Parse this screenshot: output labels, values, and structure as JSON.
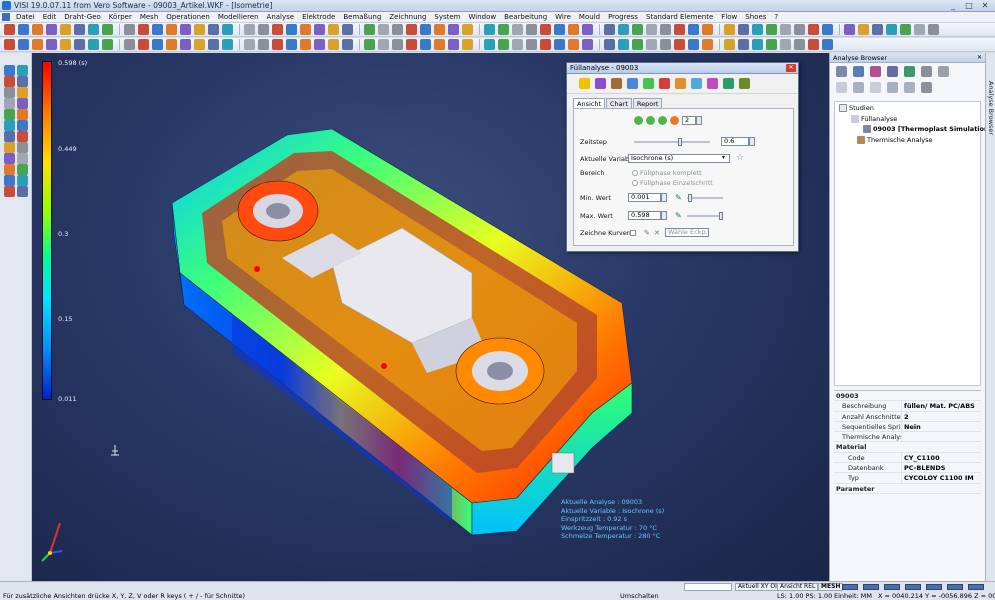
{
  "window": {
    "title": "VISI 19.0.07.11 from Vero Software - 09003_Artikel.WKF - [Isometrie]",
    "controls": [
      "_",
      "□",
      "✕"
    ]
  },
  "menu": [
    "Datei",
    "Edit",
    "Draht-Geo",
    "Körper",
    "Mesh",
    "Operationen",
    "Modellieren",
    "Analyse",
    "Elektrode",
    "Bemaßung",
    "Zeichnung",
    "System",
    "Window",
    "Bearbeitung",
    "Wire",
    "Mould",
    "Progress",
    "Standard Elemente",
    "Flow",
    "Shoes",
    "?"
  ],
  "legend": {
    "max": "0.598 (s)",
    "v1": "0.449",
    "v2": "0.3",
    "v3": "0.15",
    "min": "0.011"
  },
  "info": {
    "lines": [
      "Aktuelle Analyse :  09003",
      "Aktuelle Variable :  Isochrone (s)",
      "Einspritzzeit :  0.92 s",
      "Werkzeug Temperatur :  70 °C",
      "Schmelze Temperatur :  280 °C"
    ]
  },
  "dialog": {
    "title": "Füllanalyse - 09003",
    "close": "✕",
    "tabs": [
      "Ansicht",
      "Chart",
      "Report"
    ],
    "step_value": "2",
    "zeitstep_label": "Zeitstep",
    "zeitstep_value": "0.6",
    "variable_label": "Aktuelle Variable",
    "variable_value": "Isochrone (s)",
    "bereich_label": "Bereich",
    "bereich_opt1": "Füllphase komplett",
    "bereich_opt2": "Füllphase Einzelschritt",
    "min_label": "Min. Wert",
    "min_value": "0.001",
    "max_label": "Max. Wert",
    "max_value": "0.598",
    "curves_label": "Zeichne Kurven",
    "curves_select": "Wähle Eckp."
  },
  "browser": {
    "title": "Analyse Browser",
    "close": "✕",
    "vtab": "Analyse Browser",
    "tree": {
      "root": "Studien",
      "fill": "Füllanalyse",
      "sim": "09003 [Thermoplast Simulation]",
      "thermal": "Thermische Analyse"
    },
    "section_header": "09003",
    "props": [
      {
        "k": "Beschreibung",
        "v": "füllen/ Mat. PC/ABS"
      },
      {
        "k": "Anzahl Anschnitte",
        "v": "2"
      },
      {
        "k": "Sequentielles Spritzen",
        "v": "Nein"
      },
      {
        "k": "Thermische Analyse inkl.",
        "v": ""
      }
    ],
    "material_header": "Material",
    "material": [
      {
        "k": "Code",
        "v": "CY_C1100"
      },
      {
        "k": "Datenbank",
        "v": "PC-BLENDS"
      },
      {
        "k": "Typ",
        "v": "CYCOLOY C1100 IM"
      }
    ],
    "param_header": "Parameter"
  },
  "status": {
    "hint": "Für zusätzliche Ansichten drücke X, Y, Z, V oder R keys ( + / - für Schnitte)",
    "aktuell_xy": "Aktuell XY OI",
    "ansicht_rel": "Ansicht REL",
    "mesh": "MESH",
    "umschalten": "Umschalten",
    "ls": "LS: 1.00 PS: 1.00",
    "einheit": "Einheit: MM",
    "coords": "X = 0040.214 Y = -0056.896 Z = 0000.000"
  },
  "colors": {
    "viewport_bg": "#283866",
    "info_text": "#67c8ff",
    "accent_red": "#d23a2a"
  }
}
